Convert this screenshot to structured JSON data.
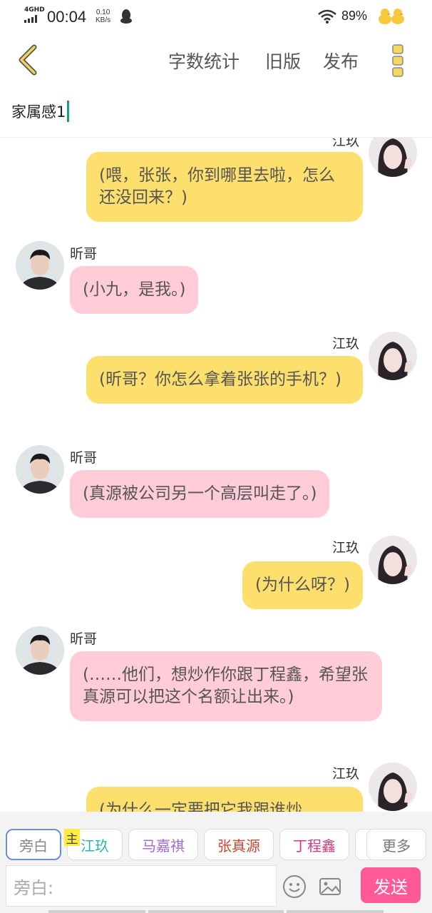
{
  "status_bar": {
    "network": "4GHD",
    "time": "00:04",
    "speed_value": "0.10",
    "speed_unit": "KB/s",
    "battery": "89%"
  },
  "toolbar": {
    "word_count": "字数统计",
    "old_version": "旧版",
    "publish": "发布"
  },
  "title_field": {
    "value": "家属感1"
  },
  "messages": [
    {
      "side": "right",
      "speaker": "江玖",
      "text": "(喂，张张，你到哪里去啦，怎么还没回来？)"
    },
    {
      "side": "left",
      "speaker": "昕哥",
      "text": "(小九，是我。)"
    },
    {
      "side": "right",
      "speaker": "江玖",
      "text": "(昕哥？你怎么拿着张张的手机？)"
    },
    {
      "side": "left",
      "speaker": "昕哥",
      "text": "(真源被公司另一个高层叫走了。)"
    },
    {
      "side": "right",
      "speaker": "江玖",
      "text": "(为什么呀？)"
    },
    {
      "side": "left",
      "speaker": "昕哥",
      "text": "(……他们，想炒作你跟丁程鑫，希望张真源可以把这个名额让出来。)"
    },
    {
      "side": "right",
      "speaker": "江玖",
      "text": "(为什么一定要把它我跟谁炒"
    }
  ],
  "characters": {
    "main_badge": "主",
    "chips": [
      {
        "label": "旁白",
        "color": "#888888"
      },
      {
        "label": "江玖",
        "color": "#2bb5a8"
      },
      {
        "label": "马嘉祺",
        "color": "#a46ad6"
      },
      {
        "label": "张真源",
        "color": "#c8482f"
      },
      {
        "label": "丁程鑫",
        "color": "#d2387e"
      },
      {
        "label": "",
        "color": "#888888"
      },
      {
        "label": "更多",
        "color": "#777777"
      }
    ]
  },
  "composer": {
    "placeholder": "旁白:",
    "send": "发送"
  },
  "colors": {
    "right_bubble": "#fddf6d",
    "left_bubble": "#ffccd8",
    "send_button": "#ff5a97",
    "back_arrow": "#e6c94b"
  },
  "icons": [
    "back-arrow-icon",
    "more-icon",
    "emoji-icon",
    "image-icon",
    "wifi-icon",
    "signal-icon",
    "qq-penguin-icon",
    "duck-icon"
  ]
}
